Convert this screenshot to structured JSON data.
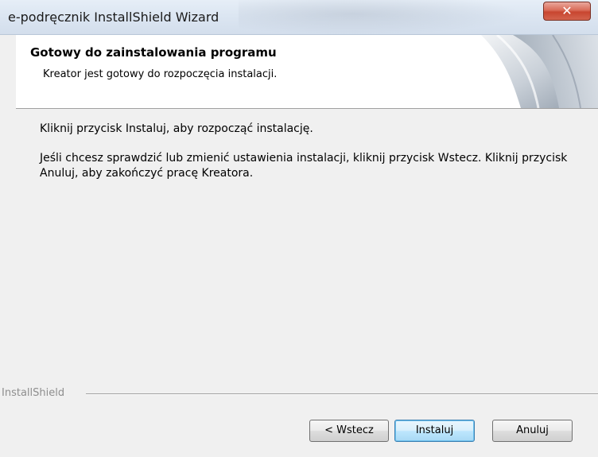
{
  "window": {
    "title": "e-podręcznik InstallShield Wizard",
    "close_icon": "close-icon"
  },
  "header": {
    "title": "Gotowy do zainstalowania programu",
    "subtitle": "Kreator jest gotowy do rozpoczęcia instalacji."
  },
  "content": {
    "paragraph_1": "Kliknij przycisk Instaluj, aby rozpocząć instalację.",
    "paragraph_2": "Jeśli chcesz sprawdzić lub zmienić ustawienia instalacji, kliknij przycisk Wstecz. Kliknij przycisk Anuluj, aby zakończyć pracę Kreatora."
  },
  "footer": {
    "brand": "InstallShield"
  },
  "buttons": {
    "back": "< Wstecz",
    "install": "Instaluj",
    "cancel": "Anuluj"
  },
  "colors": {
    "close_button": "#c84630",
    "focused_button_border": "#3c7fb1"
  }
}
